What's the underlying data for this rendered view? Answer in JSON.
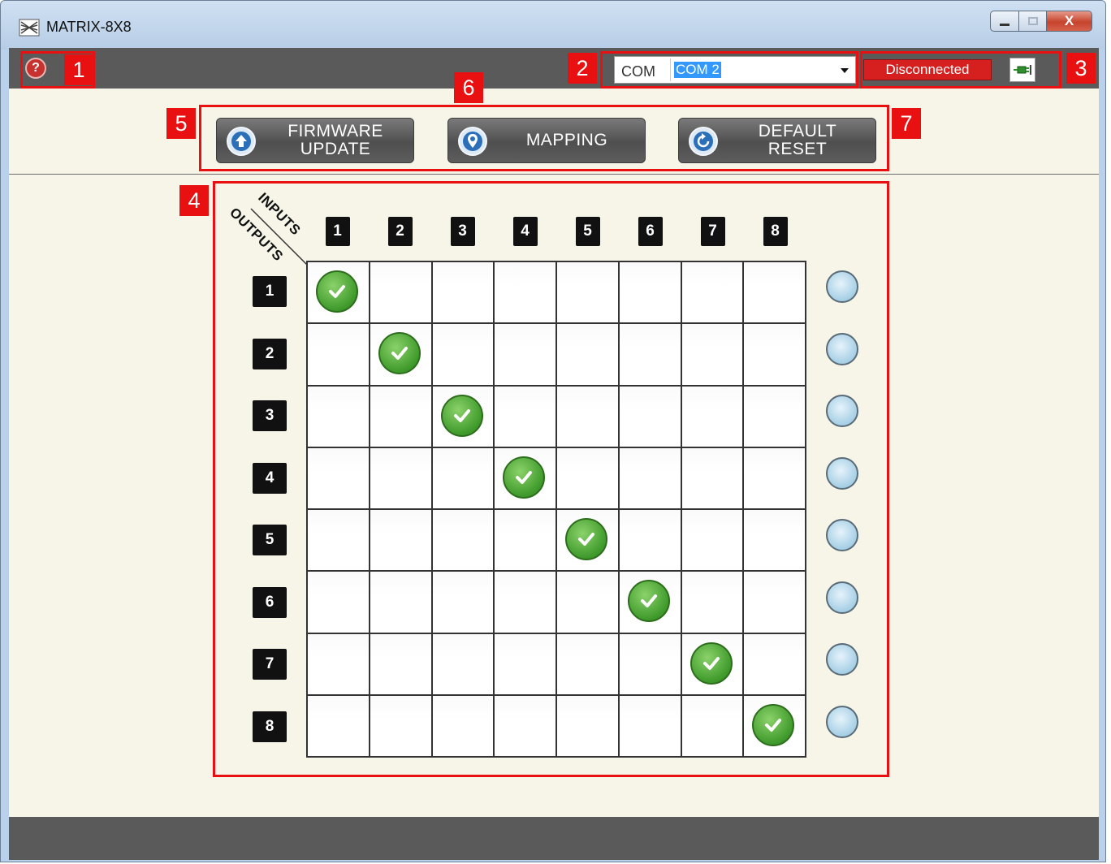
{
  "window": {
    "title": "MATRIX-8X8",
    "close_label": "X"
  },
  "toolbar": {
    "help_label": "?",
    "com_label": "COM",
    "com_value": "COM 2",
    "status": "Disconnected"
  },
  "actions": {
    "firmware_label": "FIRMWARE\nUPDATE",
    "mapping_label": "MAPPING",
    "reset_label": "DEFAULT\nRESET"
  },
  "matrix": {
    "inputs_label": "INPUTS",
    "outputs_label": "OUTPUTS",
    "inputs": [
      "1",
      "2",
      "3",
      "4",
      "5",
      "6",
      "7",
      "8"
    ],
    "outputs": [
      "1",
      "2",
      "3",
      "4",
      "5",
      "6",
      "7",
      "8"
    ],
    "mapping": [
      1,
      2,
      3,
      4,
      5,
      6,
      7,
      8
    ]
  },
  "annotations": [
    "1",
    "2",
    "3",
    "4",
    "5",
    "6",
    "7"
  ],
  "colors": {
    "annotation": "#e81010",
    "status_disconnected": "#d61f1f",
    "check": "#3f9a2b"
  }
}
